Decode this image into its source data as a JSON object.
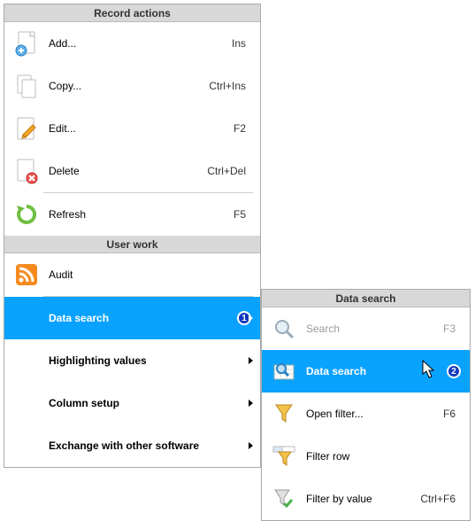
{
  "left": {
    "sections": {
      "record_actions": {
        "title": "Record actions"
      },
      "user_work": {
        "title": "User work"
      }
    },
    "items": {
      "add": {
        "label": "Add...",
        "shortcut": "Ins"
      },
      "copy": {
        "label": "Copy...",
        "shortcut": "Ctrl+Ins"
      },
      "edit": {
        "label": "Edit...",
        "shortcut": "F2"
      },
      "delete": {
        "label": "Delete",
        "shortcut": "Ctrl+Del"
      },
      "refresh": {
        "label": "Refresh",
        "shortcut": "F5"
      },
      "audit": {
        "label": "Audit"
      },
      "data_search": {
        "label": "Data search",
        "badge": "1"
      },
      "highlighting": {
        "label": "Highlighting values"
      },
      "column_setup": {
        "label": "Column setup"
      },
      "exchange": {
        "label": "Exchange with other software"
      }
    }
  },
  "right": {
    "header": {
      "title": "Data search"
    },
    "items": {
      "search": {
        "label": "Search",
        "shortcut": "F3"
      },
      "data_search": {
        "label": "Data search",
        "badge": "2"
      },
      "open_filter": {
        "label": "Open filter...",
        "shortcut": "F6"
      },
      "filter_row": {
        "label": "Filter row"
      },
      "filter_by_value": {
        "label": "Filter by value",
        "shortcut": "Ctrl+F6"
      }
    }
  }
}
